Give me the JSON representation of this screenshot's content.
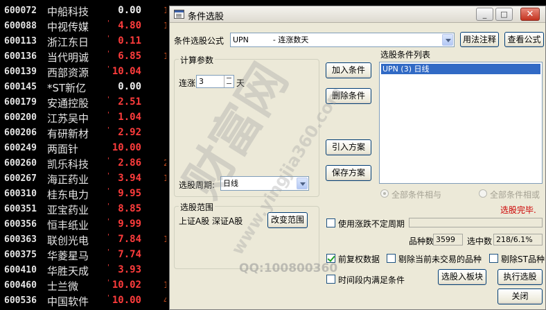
{
  "stocks": [
    {
      "code": "600072",
      "name": "中船科技",
      "price": "0.00",
      "trend": "flat",
      "edge": "1",
      "dot": ""
    },
    {
      "code": "600088",
      "name": "中视传媒",
      "price": "4.80",
      "trend": "up",
      "edge": "1",
      "dot": "'"
    },
    {
      "code": "600113",
      "name": "浙江东日",
      "price": "0.11",
      "trend": "up",
      "edge": "",
      "dot": "'"
    },
    {
      "code": "600136",
      "name": "当代明诚",
      "price": "6.85",
      "trend": "up",
      "edge": "1",
      "dot": "'"
    },
    {
      "code": "600139",
      "name": "西部资源",
      "price": "10.04",
      "trend": "up",
      "edge": "",
      "dot": "'"
    },
    {
      "code": "600145",
      "name": "*ST新亿",
      "price": "0.00",
      "trend": "flat",
      "edge": "",
      "dot": ""
    },
    {
      "code": "600179",
      "name": "安通控股",
      "price": "2.51",
      "trend": "up",
      "edge": "",
      "dot": "'"
    },
    {
      "code": "600200",
      "name": "江苏吴中",
      "price": "1.04",
      "trend": "up",
      "edge": "",
      "dot": "'"
    },
    {
      "code": "600206",
      "name": "有研新材",
      "price": "2.92",
      "trend": "up",
      "edge": "",
      "dot": "'"
    },
    {
      "code": "600249",
      "name": "两面针",
      "price": "10.00",
      "trend": "up",
      "edge": "",
      "dot": ""
    },
    {
      "code": "600260",
      "name": "凯乐科技",
      "price": "2.86",
      "trend": "up",
      "edge": "2",
      "dot": "'"
    },
    {
      "code": "600267",
      "name": "海正药业",
      "price": "3.94",
      "trend": "up",
      "edge": "1",
      "dot": "'"
    },
    {
      "code": "600310",
      "name": "桂东电力",
      "price": "9.95",
      "trend": "up",
      "edge": "",
      "dot": "'"
    },
    {
      "code": "600351",
      "name": "亚宝药业",
      "price": "8.85",
      "trend": "up",
      "edge": "",
      "dot": "'"
    },
    {
      "code": "600356",
      "name": "恒丰纸业",
      "price": "9.99",
      "trend": "up",
      "edge": "",
      "dot": "'"
    },
    {
      "code": "600363",
      "name": "联创光电",
      "price": "7.84",
      "trend": "up",
      "edge": "1",
      "dot": "'"
    },
    {
      "code": "600375",
      "name": "华菱星马",
      "price": "7.74",
      "trend": "up",
      "edge": "",
      "dot": "'"
    },
    {
      "code": "600410",
      "name": "华胜天成",
      "price": "3.93",
      "trend": "up",
      "edge": "",
      "dot": "'"
    },
    {
      "code": "600460",
      "name": "士兰微",
      "price": "10.02",
      "trend": "up",
      "edge": "1",
      "dot": "'"
    },
    {
      "code": "600536",
      "name": "中国软件",
      "price": "10.00",
      "trend": "up",
      "edge": "4",
      "dot": "'"
    }
  ],
  "dialog": {
    "title": "条件选股",
    "formula_label": "条件选股公式",
    "formula_value": "UPN          - 连涨数天",
    "usage_btn": "用法注释",
    "view_btn": "查看公式",
    "calc_group": "计算参数",
    "param_label": "连涨",
    "param_value": "3",
    "param_unit": "天",
    "period_label": "选股周期:",
    "period_value": "日线",
    "add_btn": "加入条件",
    "delete_btn": "删除条件",
    "import_btn": "引入方案",
    "save_btn": "保存方案",
    "list_label": "选股条件列表",
    "list_items": [
      "UPN (3) 日线"
    ],
    "radio_and": "全部条件相与",
    "radio_or": "全部条件相或",
    "status": "选股完毕.",
    "range_group": "选股范围",
    "range_value": "上证A股 深证A股",
    "change_range_btn": "改变范围",
    "use_period_label": "使用涨跌不定周期",
    "count_label": "品种数",
    "count_value": "3599",
    "selected_label": "选中数",
    "selected_value": "218/6.1%",
    "fq_label": "前复权数据",
    "exclude_label": "剔除当前未交易的品种",
    "exclude_st_label": "剔除ST品种",
    "time_cond_label": "时间段内满足条件",
    "to_block_btn": "选股入板块",
    "execute_btn": "执行选股",
    "close_btn": "关闭"
  },
  "watermark": {
    "brand": "财富网",
    "url": "www.yingjia360.com",
    "qq": "QQ:100800360"
  },
  "colors": {
    "up": "#ff3c3c",
    "status": "#cc0000",
    "selection": "#316ac5"
  }
}
